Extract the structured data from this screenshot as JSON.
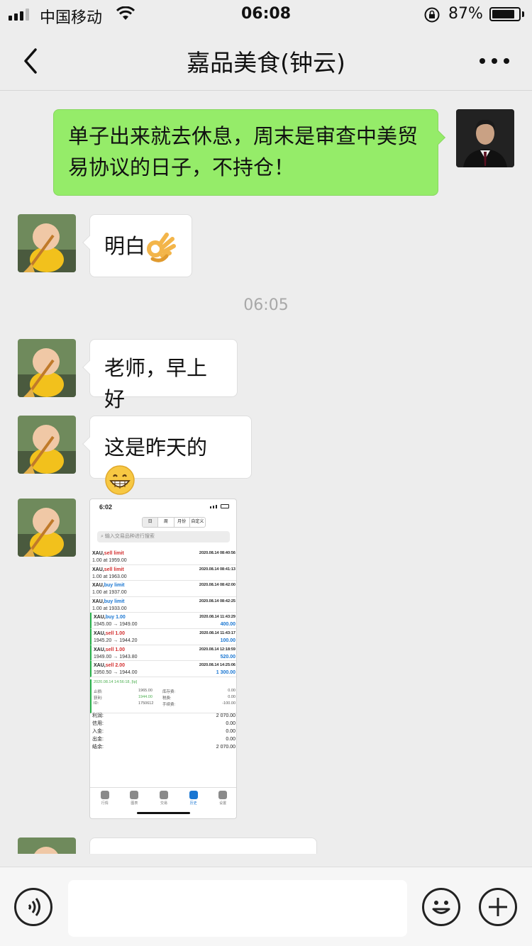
{
  "status": {
    "carrier": "中国移动",
    "time": "06:08",
    "battery_pct": "87%",
    "battery_level": 0.87
  },
  "nav": {
    "title": "嘉品美食(钟云)",
    "back_icon": "chevron-left-icon",
    "more_icon": "more-dots-icon"
  },
  "messages": [
    {
      "from": "me",
      "text": "单子出来就去休息，周末是审查中美贸易协议的日子，不持仓！"
    },
    {
      "from": "them",
      "text": "明白",
      "emoji": "ok-hand"
    },
    {
      "type": "timestamp",
      "text": "06:05"
    },
    {
      "from": "them",
      "text": "老师，早上好"
    },
    {
      "from": "them",
      "text": "这是昨天的",
      "emoji": "grinning-face"
    },
    {
      "from": "them",
      "type": "image"
    }
  ],
  "shot": {
    "time": "6:02",
    "tabs": [
      "日",
      "周",
      "月份",
      "自定义"
    ],
    "search_placeholder": "输入交易品种进行搜索",
    "orders": [
      {
        "sym": "XAU,",
        "side": "sell limit",
        "detail": "1.00 at 1959.00",
        "date": "2020.08.14 08:40:56",
        "profit": ""
      },
      {
        "sym": "XAU,",
        "side": "sell limit",
        "detail": "1.00 at 1963.00",
        "date": "2020.08.14 08:41:13",
        "profit": ""
      },
      {
        "sym": "XAU,",
        "side": "buy limit",
        "detail": "1.00 at 1937.00",
        "date": "2020.08.14 08:42:00",
        "profit": ""
      },
      {
        "sym": "XAU,",
        "side": "buy limit",
        "detail": "1.00 at 1933.00",
        "date": "2020.08.14 08:42:25",
        "profit": ""
      },
      {
        "sym": "XAU,",
        "side": "buy 1.00",
        "detail": "1945.00 → 1949.00",
        "date": "2020.08.14 11:43:29",
        "profit": "400.00"
      },
      {
        "sym": "XAU,",
        "side": "sell 1.00",
        "detail": "1945.20 → 1944.20",
        "date": "2020.08.14 11:43:17",
        "profit": "100.00"
      },
      {
        "sym": "XAU,",
        "side": "sell 1.00",
        "detail": "1949.00 → 1943.80",
        "date": "2020.08.14 12:18:59",
        "profit": "520.00"
      },
      {
        "sym": "XAU,",
        "side": "sell 2.00",
        "detail": "1950.50 → 1944.00",
        "date": "2020.08.14 14:25:06",
        "profit": "1 300.00"
      }
    ],
    "detail": {
      "datetime": "2020.08.14 14:56:18, [tp]",
      "sl_label": "止损:",
      "sl": "1965.00",
      "tp_label": "获利:",
      "tp": "1944.00",
      "id_label": "ID:",
      "id": "1750612",
      "swap_label": "库存费:",
      "swap": "0.00",
      "tax_label": "税费:",
      "tax": "0.00",
      "fee_label": "手续费:",
      "fee": "-100.00"
    },
    "summary": [
      {
        "label": "利润:",
        "value": "2 070.00"
      },
      {
        "label": "信用:",
        "value": "0.00"
      },
      {
        "label": "入金:",
        "value": "0.00"
      },
      {
        "label": "出金:",
        "value": "0.00"
      },
      {
        "label": "结余:",
        "value": "2 070.00"
      }
    ],
    "tabbar": [
      "行情",
      "图表",
      "交易",
      "历史",
      "设置"
    ]
  },
  "input": {
    "voice_icon": "voice-icon",
    "emoji_icon": "emoji-icon",
    "plus_icon": "plus-icon"
  }
}
